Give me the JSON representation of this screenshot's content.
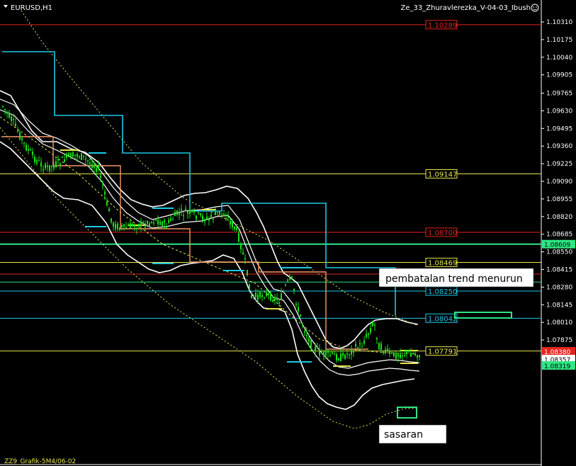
{
  "window": {
    "symbol_label": "EURUSD,H1",
    "indicator_label": "Ze_33_Zhuravlerezka_V-04-03_Ibush",
    "footer_label": "ZZ9_Grafik-5M4/06-02"
  },
  "colors": {
    "background": "#000000",
    "candle": "#19e319",
    "level_red": "#e1261c",
    "level_yellow": "#e6e64d",
    "level_cyan": "#1ec8e6",
    "level_green": "#2ee682",
    "orange_step": "#f59a6a",
    "white_envelope": "#ffffff"
  },
  "axis": {
    "ticks": [
      "1.10310",
      "1.10175",
      "1.10040",
      "1.09905",
      "1.09765",
      "1.09630",
      "1.09495",
      "1.09360",
      "1.09225",
      "1.09090",
      "1.08955",
      "1.08820",
      "1.08685",
      "1.08550",
      "1.08415",
      "1.08280",
      "1.08145",
      "1.08010",
      "1.07875",
      "1.07740"
    ]
  },
  "chart_data": {
    "type": "candlestick",
    "symbol": "EURUSD",
    "timeframe": "H1",
    "ylim": [
      1.0774,
      1.1038
    ],
    "grid": false,
    "levels": [
      {
        "value": 1.10289,
        "label": "1.10289",
        "color": "red"
      },
      {
        "value": 1.09147,
        "label": "1.09147",
        "color": "yellow"
      },
      {
        "value": 1.087,
        "label": "1.08700",
        "color": "red"
      },
      {
        "value": 1.08609,
        "label": "1.08609",
        "color": "green"
      },
      {
        "value": 1.08469,
        "label": "1.08469",
        "color": "yellow"
      },
      {
        "value": 1.0825,
        "label": "1.08250",
        "color": "cyan"
      },
      {
        "value": 1.08042,
        "label": "1.08042",
        "color": "cyan"
      },
      {
        "value": 1.07791,
        "label": "1.07791",
        "color": "yellow"
      }
    ],
    "price_markers": [
      {
        "value": 1.0838,
        "label": "1.08380",
        "style": "red"
      },
      {
        "value": 1.08357,
        "label": "1.08357",
        "style": "white"
      },
      {
        "value": 1.08319,
        "label": "1.08319",
        "style": "green"
      }
    ],
    "annotations": [
      {
        "text": "pembatalan trend menurun"
      },
      {
        "text": "sasaran"
      }
    ]
  }
}
